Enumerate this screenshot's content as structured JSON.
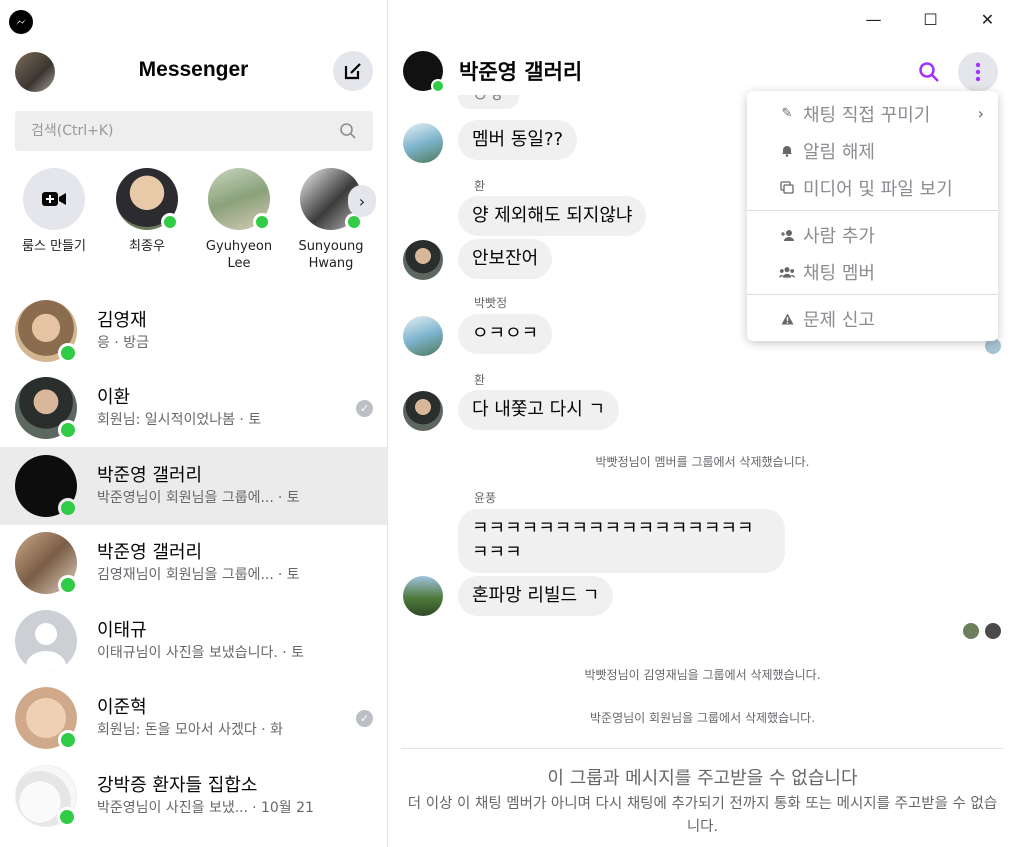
{
  "app": {
    "title": "Messenger",
    "search_placeholder": "검색(Ctrl+K)"
  },
  "window_controls": {
    "minimize": "—",
    "maximize": "☐",
    "close": "✕"
  },
  "stories": [
    {
      "label": "룸스 만들기"
    },
    {
      "label": "최종우"
    },
    {
      "label": "Gyuhyeon Lee"
    },
    {
      "label": "Sunyoung Hwang"
    }
  ],
  "chats": [
    {
      "name": "김영재",
      "preview": "응 · 방금",
      "time": ""
    },
    {
      "name": "이환",
      "preview": "회원님: 일시적이었나봄 · 토",
      "time": ""
    },
    {
      "name": "박준영 갤러리",
      "preview": "박준영님이 회원님을 그룹에...",
      "time": "· 토"
    },
    {
      "name": "박준영 갤러리",
      "preview": "김영재님이 회원님을 그룹에...",
      "time": "· 토"
    },
    {
      "name": "이태규",
      "preview": "이태규님이 사진을 보냈습니다. · 토",
      "time": ""
    },
    {
      "name": "이준혁",
      "preview": "회원님: 돈을 모아서 사겠다 · 화",
      "time": ""
    },
    {
      "name": "강박증 환자들 집합소",
      "preview": "박준영님이 사진을 보냈...",
      "time": "· 10월 21"
    }
  ],
  "conversation": {
    "title": "박준영 갤러리",
    "messages": {
      "partial": "ㅇㅎ",
      "m1": "멤버 동일??",
      "sender2": "환",
      "m2": "양 제외해도 되지않냐",
      "m3": "안보잔어",
      "sender3": "박빳정",
      "m4": "ㅇㅋㅇㅋ",
      "sender4": "환",
      "m5": "다 내쫓고 다시 ㄱ",
      "sys1": "박빳정님이 멤버를 그룹에서 삭제했습니다.",
      "sender5": "윤풍",
      "m6_line1": "ㅋㅋㅋㅋㅋㅋㅋㅋㅋㅋㅋㅋㅋㅋㅋㅋㅋ",
      "m6_line2": "ㅋㅋㅋ",
      "m7": "혼파망 리빌드 ㄱ",
      "sys2": "박빳정님이 김영재님을 그룹에서 삭제했습니다.",
      "sys3": "박준영님이 회원님을 그룹에서 삭제했습니다."
    },
    "notice_title": "이 그룹과 메시지를 주고받을 수 없습니다",
    "notice_body": "더 이상 이 채팅 멤버가 아니며 다시 채팅에 추가되기 전까지 통화 또는 메시지를 주고받을 수 없습니다."
  },
  "menu": {
    "customize": "채팅 직접 꾸미기",
    "unmute": "알림 해제",
    "media": "미디어 및 파일 보기",
    "add_people": "사람 추가",
    "members": "채팅 멤버",
    "report": "문제 신고"
  },
  "colors": {
    "accent": "#a033ff",
    "online": "#31cc46",
    "bubble": "#f0f0f0"
  }
}
